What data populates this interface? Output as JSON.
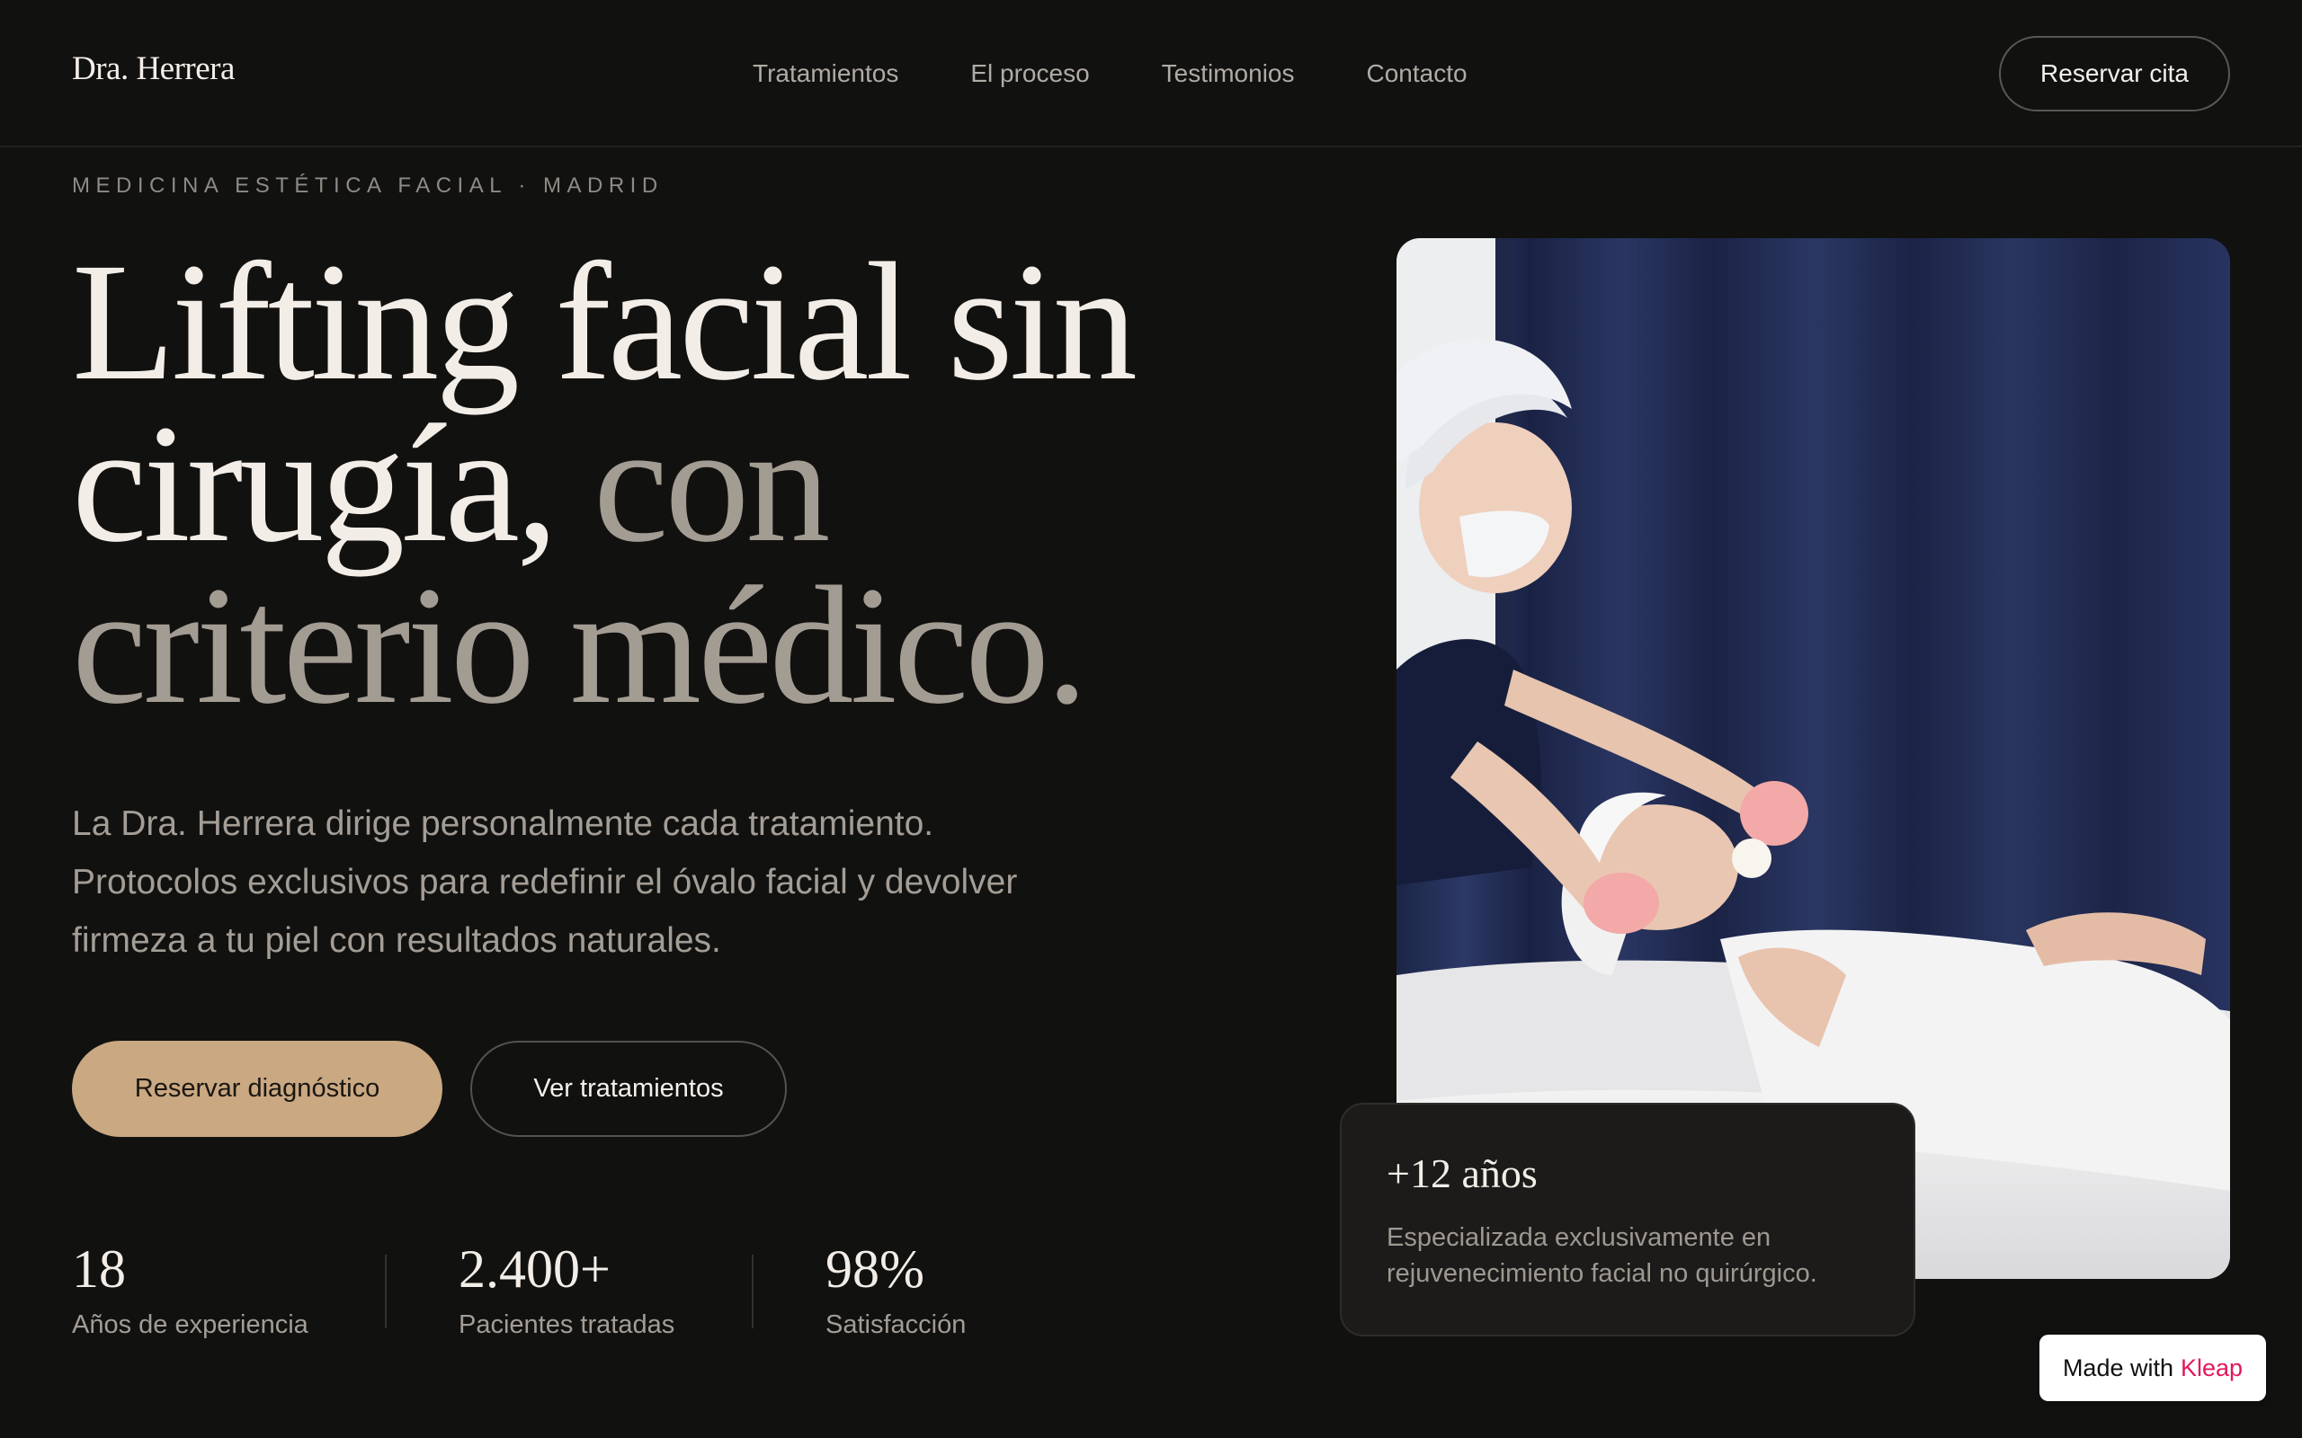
{
  "header": {
    "logo": "Dra. Herrera",
    "nav": [
      "Tratamientos",
      "El proceso",
      "Testimonios",
      "Contacto"
    ],
    "cta": "Reservar cita"
  },
  "hero": {
    "eyebrow": "MEDICINA ESTÉTICA FACIAL · MADRID",
    "headline": {
      "line1": "Lifting facial sin",
      "line2_light": "cirugía,",
      "line2_muted": "con",
      "line3": "criterio médico."
    },
    "lede": "La Dra. Herrera dirige personalmente cada tratamiento. Protocolos exclusivos para redefinir el óvalo facial y devolver firmeza a tu piel con resultados naturales.",
    "primary_cta": "Reservar diagnóstico",
    "secondary_cta": "Ver tratamientos",
    "stats": [
      {
        "value": "18",
        "label": "Años de experiencia"
      },
      {
        "value": "2.400+",
        "label": "Pacientes tratadas"
      },
      {
        "value": "98%",
        "label": "Satisfacción"
      }
    ]
  },
  "card": {
    "title": "+12 años",
    "description": "Especializada exclusivamente en rejuvenecimiento facial no quirúrgico."
  },
  "badge": {
    "prefix": "Made with",
    "brand": "Kleap"
  },
  "colors": {
    "background": "#111110",
    "accent": "#c9a882",
    "text_light": "#f2ede6",
    "text_muted": "#a39c93",
    "badge_brand": "#e2185b"
  }
}
